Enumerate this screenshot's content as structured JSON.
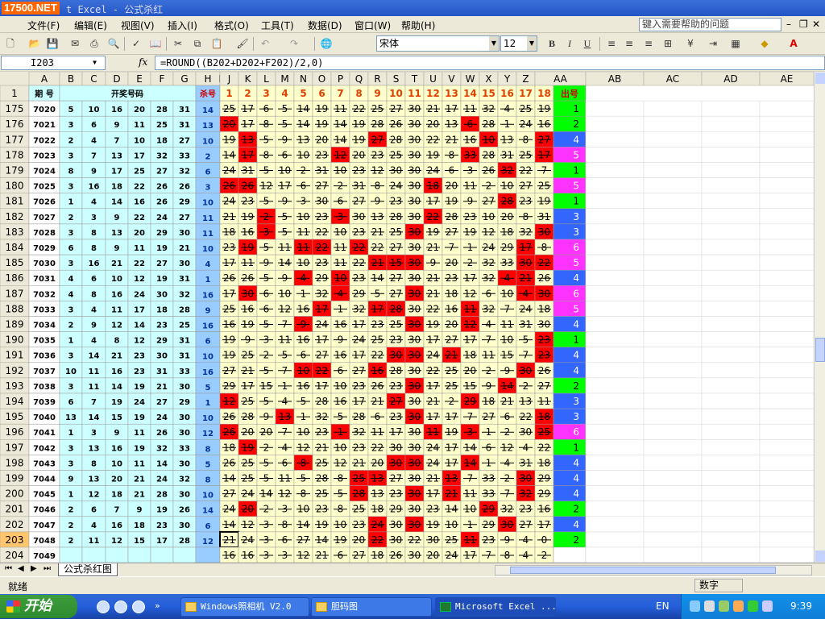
{
  "window": {
    "logo": "17500.NET",
    "title": "t Excel - 公式杀红"
  },
  "menu": [
    "文件(F)",
    "编辑(E)",
    "视图(V)",
    "插入(I)",
    "格式(O)",
    "工具(T)",
    "数据(D)",
    "窗口(W)",
    "帮助(H)"
  ],
  "help_box": "键入需要帮助的问题",
  "toolbar": {
    "font": "宋体",
    "size": "12",
    "bold": "B",
    "italic": "I",
    "underline": "U"
  },
  "formula_bar": {
    "name_box": "I203",
    "fx": "fx",
    "formula": "=ROUND((B202+D202+F202)/2,0)"
  },
  "columns": [
    "A",
    "B",
    "C",
    "D",
    "E",
    "F",
    "G",
    "H",
    "I",
    "J",
    "K",
    "L",
    "M",
    "N",
    "O",
    "P",
    "Q",
    "R",
    "S",
    "T",
    "U",
    "V",
    "W",
    "X",
    "Y",
    "Z",
    "AA",
    "AB",
    "AC",
    "AD",
    "AE"
  ],
  "header_row": {
    "row": "1",
    "a": "期 号",
    "bg": "开奖号码",
    "h": "杀号",
    "nums": [
      "1",
      "2",
      "3",
      "4",
      "5",
      "6",
      "7",
      "8",
      "9",
      "10",
      "11",
      "12",
      "13",
      "14",
      "15",
      "16",
      "17",
      "18"
    ],
    "aa": "出号"
  },
  "rows": [
    {
      "row": "175",
      "issue": "7020",
      "draw": [
        5,
        10,
        16,
        20,
        28,
        31
      ],
      "kill": 14,
      "cells": [
        25,
        17,
        6,
        5,
        14,
        19,
        11,
        22,
        25,
        27,
        30,
        21,
        17,
        11,
        32,
        4,
        25,
        19
      ],
      "red": [],
      "out": 1
    },
    {
      "row": "176",
      "issue": "7021",
      "draw": [
        3,
        6,
        9,
        11,
        25,
        31
      ],
      "kill": 13,
      "cells": [
        20,
        17,
        8,
        5,
        14,
        19,
        14,
        19,
        28,
        26,
        30,
        20,
        13,
        6,
        28,
        1,
        24,
        16
      ],
      "red": [
        0,
        13
      ],
      "out": 2
    },
    {
      "row": "177",
      "issue": "7022",
      "draw": [
        2,
        4,
        7,
        10,
        18,
        27
      ],
      "kill": 10,
      "cells": [
        19,
        13,
        5,
        9,
        13,
        20,
        14,
        19,
        27,
        28,
        30,
        22,
        21,
        16,
        10,
        13,
        8,
        27
      ],
      "red": [
        1,
        8,
        14,
        17
      ],
      "out": 4
    },
    {
      "row": "178",
      "issue": "7023",
      "draw": [
        3,
        7,
        13,
        17,
        32,
        33
      ],
      "kill": 2,
      "cells": [
        14,
        17,
        8,
        6,
        10,
        23,
        12,
        20,
        23,
        25,
        30,
        19,
        8,
        33,
        28,
        31,
        25,
        17
      ],
      "red": [
        1,
        6,
        13,
        17
      ],
      "out": 5
    },
    {
      "row": "179",
      "issue": "7024",
      "draw": [
        8,
        9,
        17,
        25,
        27,
        32
      ],
      "kill": 6,
      "cells": [
        24,
        31,
        5,
        10,
        2,
        31,
        10,
        23,
        12,
        30,
        30,
        24,
        6,
        3,
        26,
        32,
        22,
        7
      ],
      "red": [
        15
      ],
      "out": 1
    },
    {
      "row": "180",
      "issue": "7025",
      "draw": [
        3,
        16,
        18,
        22,
        26,
        26
      ],
      "kill": 3,
      "cells": [
        26,
        26,
        12,
        17,
        6,
        27,
        2,
        31,
        8,
        24,
        30,
        18,
        20,
        11,
        2,
        10,
        27,
        25
      ],
      "red": [
        0,
        1,
        11
      ],
      "out": 5
    },
    {
      "row": "181",
      "issue": "7026",
      "draw": [
        1,
        4,
        14,
        16,
        26,
        29
      ],
      "kill": 10,
      "cells": [
        24,
        23,
        5,
        9,
        3,
        30,
        6,
        27,
        9,
        23,
        30,
        17,
        19,
        9,
        27,
        28,
        23,
        19
      ],
      "red": [
        15
      ],
      "out": 1
    },
    {
      "row": "182",
      "issue": "7027",
      "draw": [
        2,
        3,
        9,
        22,
        24,
        27
      ],
      "kill": 11,
      "cells": [
        21,
        19,
        2,
        5,
        10,
        23,
        3,
        30,
        13,
        28,
        30,
        22,
        28,
        23,
        10,
        20,
        8,
        31
      ],
      "red": [
        2,
        6,
        11
      ],
      "out": 3
    },
    {
      "row": "183",
      "issue": "7028",
      "draw": [
        3,
        8,
        13,
        20,
        29,
        30
      ],
      "kill": 11,
      "cells": [
        18,
        16,
        3,
        5,
        11,
        22,
        10,
        23,
        21,
        25,
        30,
        19,
        27,
        19,
        12,
        18,
        32,
        30
      ],
      "red": [
        2,
        10,
        17
      ],
      "out": 3
    },
    {
      "row": "184",
      "issue": "7029",
      "draw": [
        6,
        8,
        9,
        11,
        19,
        21
      ],
      "kill": 10,
      "cells": [
        23,
        19,
        5,
        11,
        11,
        22,
        11,
        22,
        22,
        27,
        30,
        21,
        7,
        1,
        24,
        29,
        17,
        8
      ],
      "red": [
        1,
        4,
        5,
        7,
        16
      ],
      "out": 6
    },
    {
      "row": "185",
      "issue": "7030",
      "draw": [
        3,
        16,
        21,
        22,
        27,
        30
      ],
      "kill": 4,
      "cells": [
        17,
        11,
        9,
        14,
        10,
        23,
        11,
        22,
        21,
        15,
        30,
        9,
        20,
        2,
        32,
        33,
        30,
        22
      ],
      "red": [
        8,
        9,
        10,
        16,
        17
      ],
      "out": 5
    },
    {
      "row": "186",
      "issue": "7031",
      "draw": [
        4,
        6,
        10,
        12,
        19,
        31
      ],
      "kill": 1,
      "cells": [
        26,
        26,
        5,
        9,
        4,
        29,
        10,
        23,
        14,
        27,
        30,
        21,
        23,
        17,
        32,
        4,
        21,
        26
      ],
      "red": [
        4,
        6,
        15,
        16
      ],
      "out": 4
    },
    {
      "row": "187",
      "issue": "7032",
      "draw": [
        4,
        8,
        16,
        24,
        30,
        32
      ],
      "kill": 16,
      "cells": [
        17,
        30,
        6,
        10,
        1,
        32,
        4,
        29,
        5,
        27,
        30,
        21,
        18,
        12,
        6,
        10,
        4,
        30
      ],
      "red": [
        1,
        6,
        10,
        16,
        17
      ],
      "out": 6
    },
    {
      "row": "188",
      "issue": "7033",
      "draw": [
        3,
        4,
        11,
        17,
        18,
        28
      ],
      "kill": 9,
      "cells": [
        25,
        16,
        6,
        12,
        16,
        17,
        1,
        32,
        17,
        28,
        30,
        22,
        16,
        11,
        32,
        7,
        24,
        18
      ],
      "red": [
        5,
        8,
        9,
        13
      ],
      "out": 5
    },
    {
      "row": "189",
      "issue": "7034",
      "draw": [
        2,
        9,
        12,
        14,
        23,
        25
      ],
      "kill": 16,
      "cells": [
        16,
        19,
        5,
        7,
        9,
        24,
        16,
        17,
        23,
        25,
        30,
        19,
        20,
        12,
        4,
        11,
        31,
        30
      ],
      "red": [
        4,
        10,
        13
      ],
      "out": 4
    },
    {
      "row": "190",
      "issue": "7035",
      "draw": [
        1,
        4,
        8,
        12,
        29,
        31
      ],
      "kill": 6,
      "cells": [
        19,
        9,
        3,
        11,
        16,
        17,
        9,
        24,
        25,
        23,
        30,
        17,
        27,
        17,
        7,
        10,
        5,
        23
      ],
      "red": [
        17
      ],
      "out": 1
    },
    {
      "row": "191",
      "issue": "7036",
      "draw": [
        3,
        14,
        21,
        23,
        30,
        31
      ],
      "kill": 10,
      "cells": [
        19,
        25,
        2,
        5,
        6,
        27,
        16,
        17,
        22,
        30,
        30,
        24,
        21,
        18,
        11,
        15,
        7,
        23
      ],
      "red": [
        9,
        10,
        12,
        17
      ],
      "out": 4
    },
    {
      "row": "192",
      "issue": "7037",
      "draw": [
        10,
        11,
        16,
        23,
        31,
        33
      ],
      "kill": 16,
      "cells": [
        27,
        21,
        5,
        7,
        10,
        22,
        6,
        27,
        16,
        28,
        30,
        22,
        25,
        20,
        2,
        9,
        30,
        26
      ],
      "red": [
        4,
        5,
        8,
        16
      ],
      "out": 4
    },
    {
      "row": "193",
      "issue": "7038",
      "draw": [
        3,
        11,
        14,
        19,
        21,
        30
      ],
      "kill": 5,
      "cells": [
        29,
        17,
        15,
        1,
        16,
        17,
        10,
        23,
        26,
        23,
        30,
        17,
        25,
        15,
        9,
        14,
        2,
        27
      ],
      "red": [
        10,
        15
      ],
      "out": 2
    },
    {
      "row": "194",
      "issue": "7039",
      "draw": [
        6,
        7,
        19,
        24,
        27,
        29
      ],
      "kill": 1,
      "cells": [
        12,
        25,
        5,
        4,
        5,
        28,
        16,
        17,
        21,
        27,
        30,
        21,
        2,
        29,
        18,
        21,
        13,
        11
      ],
      "red": [
        0,
        9,
        13
      ],
      "out": 3
    },
    {
      "row": "195",
      "issue": "7040",
      "draw": [
        13,
        14,
        15,
        19,
        24,
        30
      ],
      "kill": 10,
      "cells": [
        26,
        28,
        9,
        13,
        1,
        32,
        5,
        28,
        6,
        23,
        30,
        17,
        17,
        7,
        27,
        6,
        22,
        18
      ],
      "red": [
        3,
        10,
        17
      ],
      "out": 3
    },
    {
      "row": "196",
      "issue": "7041",
      "draw": [
        1,
        3,
        9,
        11,
        26,
        30
      ],
      "kill": 12,
      "cells": [
        26,
        20,
        20,
        7,
        10,
        23,
        1,
        32,
        11,
        17,
        30,
        11,
        19,
        3,
        1,
        2,
        30,
        25
      ],
      "red": [
        0,
        6,
        11,
        13,
        17
      ],
      "out": 6
    },
    {
      "row": "197",
      "issue": "7042",
      "draw": [
        3,
        13,
        16,
        19,
        32,
        33
      ],
      "kill": 8,
      "cells": [
        18,
        19,
        2,
        4,
        12,
        21,
        10,
        23,
        22,
        30,
        30,
        24,
        17,
        14,
        6,
        12,
        4,
        22
      ],
      "red": [
        1
      ],
      "out": 1
    },
    {
      "row": "198",
      "issue": "7043",
      "draw": [
        3,
        8,
        10,
        11,
        14,
        30
      ],
      "kill": 5,
      "cells": [
        26,
        25,
        5,
        6,
        8,
        25,
        12,
        21,
        20,
        30,
        30,
        24,
        17,
        14,
        1,
        4,
        31,
        18
      ],
      "red": [
        4,
        9,
        10,
        13
      ],
      "out": 4
    },
    {
      "row": "199",
      "issue": "7044",
      "draw": [
        9,
        13,
        20,
        21,
        24,
        32
      ],
      "kill": 8,
      "cells": [
        14,
        25,
        5,
        11,
        5,
        28,
        8,
        25,
        13,
        27,
        30,
        21,
        13,
        7,
        33,
        2,
        30,
        29
      ],
      "red": [
        7,
        8,
        12,
        16
      ],
      "out": 4
    },
    {
      "row": "200",
      "issue": "7045",
      "draw": [
        1,
        12,
        18,
        21,
        28,
        30
      ],
      "kill": 10,
      "cells": [
        27,
        24,
        14,
        12,
        8,
        25,
        5,
        28,
        13,
        23,
        30,
        17,
        21,
        11,
        33,
        7,
        32,
        29
      ],
      "red": [
        7,
        10,
        12,
        16
      ],
      "out": 4
    },
    {
      "row": "201",
      "issue": "7046",
      "draw": [
        2,
        6,
        7,
        9,
        19,
        26
      ],
      "kill": 14,
      "cells": [
        24,
        20,
        2,
        3,
        10,
        23,
        8,
        25,
        18,
        29,
        30,
        23,
        14,
        10,
        29,
        32,
        23,
        16
      ],
      "red": [
        1,
        14
      ],
      "out": 2
    },
    {
      "row": "202",
      "issue": "7047",
      "draw": [
        2,
        4,
        16,
        18,
        23,
        30
      ],
      "kill": 6,
      "cells": [
        14,
        12,
        3,
        8,
        14,
        19,
        10,
        23,
        24,
        30,
        30,
        19,
        10,
        1,
        29,
        30,
        27,
        17
      ],
      "red": [
        8,
        10,
        15
      ],
      "out": 4
    },
    {
      "row": "203",
      "issue": "7048",
      "draw": [
        2,
        11,
        12,
        15,
        17,
        28
      ],
      "kill": 12,
      "cells": [
        21,
        24,
        3,
        6,
        27,
        14,
        19,
        20,
        22,
        30,
        22,
        30,
        25,
        11,
        23,
        9,
        4,
        0
      ],
      "red": [
        8,
        13
      ],
      "out": 2
    },
    {
      "row": "204",
      "issue": "7049",
      "draw": [],
      "kill": null,
      "cells": [
        16,
        16,
        3,
        3,
        12,
        21,
        6,
        27,
        18,
        26,
        30,
        20,
        24,
        17,
        7,
        8,
        4,
        2
      ],
      "red": [],
      "out": null
    }
  ],
  "sheet_tab": "公式杀红图",
  "status": {
    "ready": "就绪",
    "num": "数字"
  },
  "taskbar": {
    "start": "开始",
    "tasks": [
      "Windows照相机 V2.0",
      "胆码图",
      "Microsoft Excel ..."
    ],
    "lang": "EN",
    "clock": "9:39"
  },
  "colors": {
    "header_cyan": "#ccffff",
    "kill_col": "#99ccff",
    "cell_yellow": "#ffffcc",
    "cell_red": "#ff0000",
    "out_green": "#00ff00",
    "out_blue": "#3366ff",
    "out_magenta": "#ff33ff"
  }
}
